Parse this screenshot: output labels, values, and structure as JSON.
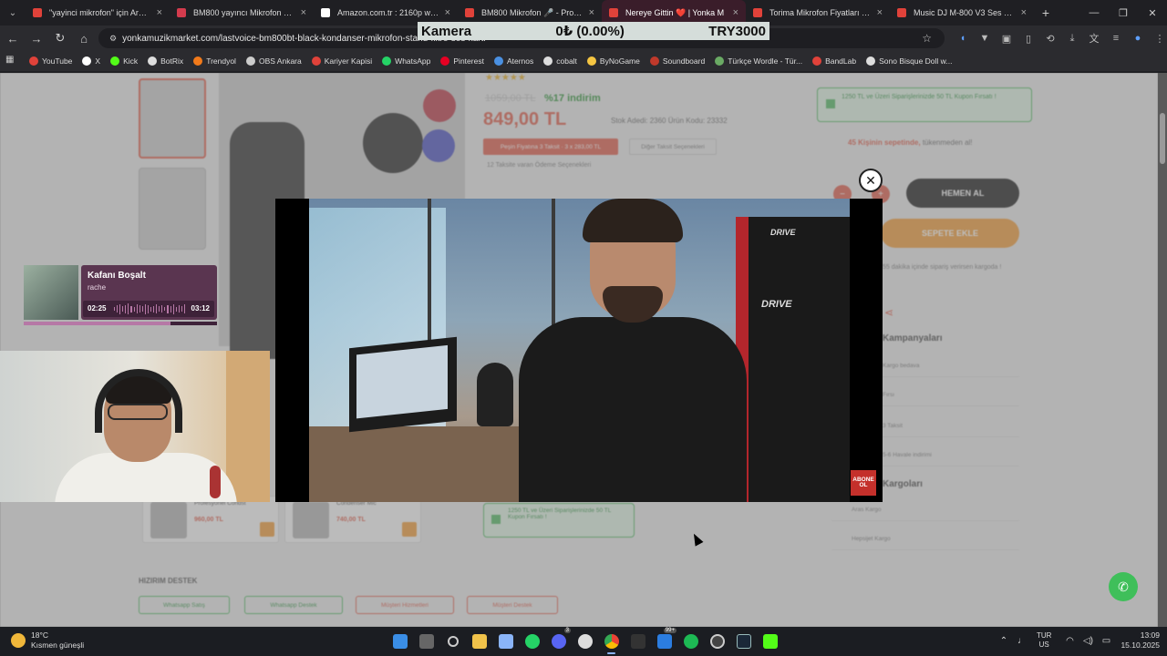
{
  "browser": {
    "tabs": [
      {
        "title": "\"yayinci mikrofon\" için Arama S",
        "favicon_color": "#e0423a",
        "active": false
      },
      {
        "title": "BM800 yayıncı Mikrofon Seti | T",
        "favicon_color": "#d33b4d",
        "active": false
      },
      {
        "title": "Amazon.com.tr : 2160p webcam",
        "favicon_color": "#ffffff",
        "active": false
      },
      {
        "title": "BM800 Mikrofon 🎤 - Profesyo",
        "favicon_color": "#e0423a",
        "active": false
      },
      {
        "title": "Nereye Gittin ❤️ | Yonka M",
        "favicon_color": "#e0423a",
        "active": true
      },
      {
        "title": "Torima Mikrofon Fiyatları ve Yo",
        "favicon_color": "#e0423a",
        "active": false
      },
      {
        "title": "Music DJ M-800 V3 Ses Kartlı S",
        "favicon_color": "#e0423a",
        "active": false
      }
    ],
    "url": "yonkamuzikmarket.com/lastvoice-bm800bt-black-kondanser-mikrofon-stand-filtre-ses-karti",
    "bookmarks": [
      {
        "label": "YouTube",
        "color": "#e0423a"
      },
      {
        "label": "X",
        "color": "#ffffff"
      },
      {
        "label": "Kick",
        "color": "#53fc18"
      },
      {
        "label": "BotRix",
        "color": "#dddddd"
      },
      {
        "label": "Trendyol",
        "color": "#f27a1a"
      },
      {
        "label": "OBS Ankara",
        "color": "#cccccc"
      },
      {
        "label": "Kariyer Kapisi",
        "color": "#e0423a"
      },
      {
        "label": "WhatsApp",
        "color": "#25d366"
      },
      {
        "label": "Pinterest",
        "color": "#e60023"
      },
      {
        "label": "Aternos",
        "color": "#4a90e2"
      },
      {
        "label": "cobalt",
        "color": "#dddddd"
      },
      {
        "label": "ByNoGame",
        "color": "#f5c542"
      },
      {
        "label": "Soundboard",
        "color": "#c0392b"
      },
      {
        "label": "Türkçe Wordle - Tür...",
        "color": "#6aaa64"
      },
      {
        "label": "BandLab",
        "color": "#e0423a"
      },
      {
        "label": "Sono Bisque Doll w...",
        "color": "#dddddd"
      }
    ]
  },
  "stream_overlay": {
    "label": "Kamera",
    "value": "0₺ (0.00%)",
    "target": "TRY3000"
  },
  "product_page": {
    "old_price": "1059,00 TL",
    "discount": "%17 indirim",
    "price": "849,00 TL",
    "stock_text": "Stok Adedi: 2360   Ürün Kodu: 23332",
    "installment_btn": "Peşin Fiyatına 3 Taksit · 3 x 283,00 TL",
    "other_installments_btn": "Diğer Taksit Seçenekleri",
    "card_note": "12 Taksite varan Ödeme Seçenekleri",
    "promo_text": "1250 TL ve Üzeri Siparişlerinizde 50 TL Kupon Fırsatı !",
    "cart_count_highlight": "45 Kişinin sepetinde,",
    "cart_count_rest": "tükenmeden al!",
    "buy_now": "HEMEN AL",
    "add_to_cart": "SEPETE EKLE",
    "ship_note": "55 dakika içinde sipariş verirsen kargoda !",
    "campaigns_title": "Kampanyaları",
    "campaign_rows": [
      "Kargo bedava",
      "Fırsı",
      "3 Taksit",
      "5-6 Havale indirimi"
    ],
    "shipping_title": "Kargoları",
    "shipping_rows": [
      "Aras Kargo",
      "Hepsijet Kargo"
    ],
    "related": [
      {
        "title": "Profesyonel Condst",
        "price": "960,00 TL"
      },
      {
        "title": "Condenser Mic",
        "price": "740,00 TL"
      }
    ],
    "promo2_text": "1250 TL ve Üzeri Siparişlerinizde 50 TL Kupon Fırsatı !",
    "support_title": "HIZIRIM DESTEK",
    "support_buttons": [
      "Whatsapp Satış",
      "Whatsapp Destek",
      "Müşteri Hizmetleri",
      "Müşteri Destek"
    ]
  },
  "video": {
    "chair_brand": "DRIVE",
    "subscribe_badge_line1": "ABONE",
    "subscribe_badge_line2": "OL"
  },
  "spotify": {
    "title": "Kafanı Boşalt",
    "artist": "rache",
    "current_time": "02:25",
    "total_time": "03:12",
    "progress": 0.76
  },
  "taskbar": {
    "temperature": "18°C",
    "weather_desc": "Kısmen güneşli",
    "mail_badge": "99+",
    "discord_badge": "3",
    "lang_line1": "TUR",
    "lang_line2": "US",
    "time": "13:09",
    "date": "15.10.2025"
  }
}
